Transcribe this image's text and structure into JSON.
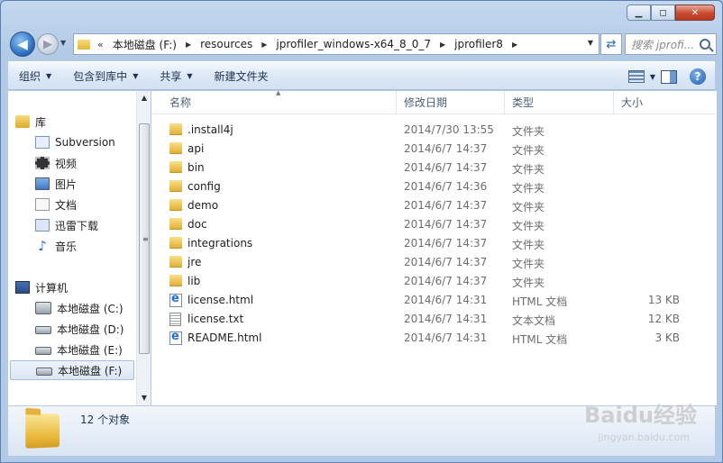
{
  "window": {
    "caption_min": "▁",
    "caption_max": "◻",
    "caption_close": "✕"
  },
  "address": {
    "overflow_marker": "«",
    "crumbs": [
      "本地磁盘 (F:)",
      "resources",
      "jprofiler_windows-x64_8_0_7",
      "jprofiler8"
    ],
    "search_placeholder": "搜索 jprofi..."
  },
  "toolbar": {
    "organize": "组织",
    "include_in_library": "包含到库中",
    "share": "共享",
    "new_folder": "新建文件夹"
  },
  "nav": {
    "library": "库",
    "library_items": [
      "Subversion",
      "视频",
      "图片",
      "文档",
      "迅雷下载",
      "音乐"
    ],
    "computer": "计算机",
    "drives": [
      "本地磁盘 (C:)",
      "本地磁盘 (D:)",
      "本地磁盘 (E:)",
      "本地磁盘 (F:)"
    ]
  },
  "columns": {
    "name": "名称",
    "date": "修改日期",
    "type": "类型",
    "size": "大小"
  },
  "files": [
    {
      "name": ".install4j",
      "date": "2014/7/30 13:55",
      "type": "文件夹",
      "size": "",
      "icon": "folder-icon"
    },
    {
      "name": "api",
      "date": "2014/6/7 14:37",
      "type": "文件夹",
      "size": "",
      "icon": "folder-icon"
    },
    {
      "name": "bin",
      "date": "2014/6/7 14:37",
      "type": "文件夹",
      "size": "",
      "icon": "folder-icon"
    },
    {
      "name": "config",
      "date": "2014/6/7 14:36",
      "type": "文件夹",
      "size": "",
      "icon": "folder-icon"
    },
    {
      "name": "demo",
      "date": "2014/6/7 14:37",
      "type": "文件夹",
      "size": "",
      "icon": "folder-icon"
    },
    {
      "name": "doc",
      "date": "2014/6/7 14:37",
      "type": "文件夹",
      "size": "",
      "icon": "folder-icon"
    },
    {
      "name": "integrations",
      "date": "2014/6/7 14:37",
      "type": "文件夹",
      "size": "",
      "icon": "folder-icon"
    },
    {
      "name": "jre",
      "date": "2014/6/7 14:37",
      "type": "文件夹",
      "size": "",
      "icon": "folder-icon"
    },
    {
      "name": "lib",
      "date": "2014/6/7 14:37",
      "type": "文件夹",
      "size": "",
      "icon": "folder-icon"
    },
    {
      "name": "license.html",
      "date": "2014/6/7 14:31",
      "type": "HTML 文档",
      "size": "13 KB",
      "icon": "html-file-icon"
    },
    {
      "name": "license.txt",
      "date": "2014/6/7 14:31",
      "type": "文本文档",
      "size": "12 KB",
      "icon": "text-file-icon"
    },
    {
      "name": "README.html",
      "date": "2014/6/7 14:31",
      "type": "HTML 文档",
      "size": "3 KB",
      "icon": "html-file-icon"
    }
  ],
  "details": {
    "object_count": "12 个对象"
  },
  "watermark": {
    "brand": "Baidu经验",
    "url": "jingyan.baidu.com"
  }
}
